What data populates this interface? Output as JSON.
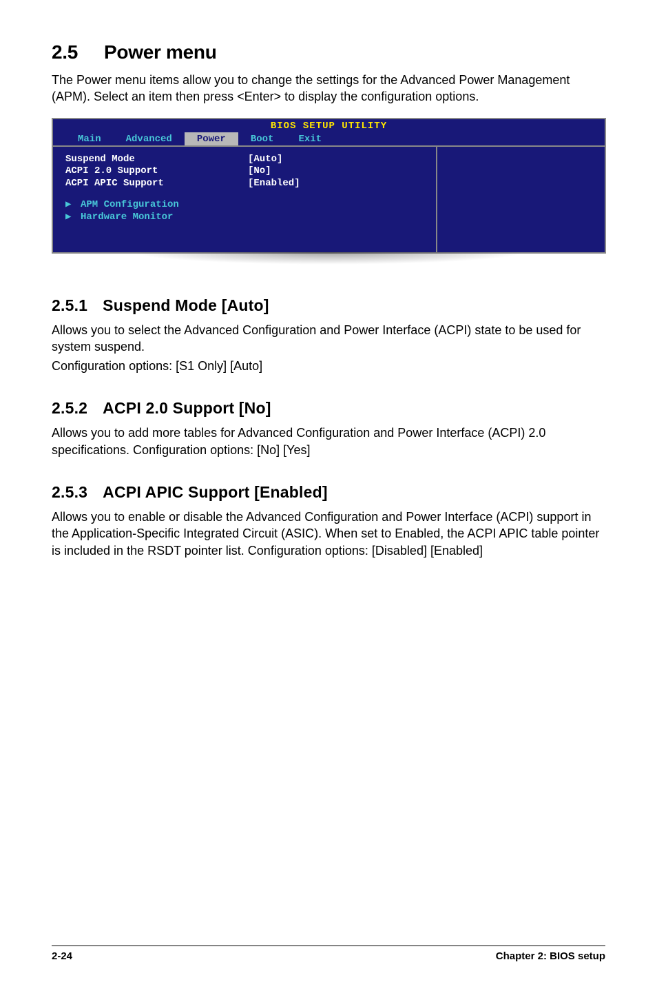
{
  "heading": {
    "number": "2.5",
    "title": "Power menu"
  },
  "intro": "The Power menu items allow you to change the settings for the Advanced Power Management (APM). Select an item then press <Enter> to display the configuration options.",
  "bios": {
    "title": "BIOS SETUP UTILITY",
    "tabs": {
      "main": "Main",
      "advanced": "Advanced",
      "power": "Power",
      "boot": "Boot",
      "exit": "Exit"
    },
    "rows": {
      "suspend_label": "Suspend Mode",
      "suspend_value": "[Auto]",
      "acpi20_label": "ACPI 2.0 Support",
      "acpi20_value": "[No]",
      "apic_label": "ACPI APIC Support",
      "apic_value": "[Enabled]"
    },
    "submenus": {
      "apm": "APM Configuration",
      "hw": "Hardware Monitor"
    }
  },
  "sections": {
    "s1": {
      "num": "2.5.1",
      "title": "Suspend Mode [Auto]",
      "p1": "Allows you to select the Advanced Configuration and Power Interface (ACPI) state to be used for system suspend.",
      "p2": "Configuration options: [S1 Only] [Auto]"
    },
    "s2": {
      "num": "2.5.2",
      "title": "ACPI 2.0 Support [No]",
      "p1": "Allows you to add more tables for Advanced Configuration and Power Interface (ACPI) 2.0 specifications. Configuration options: [No] [Yes]"
    },
    "s3": {
      "num": "2.5.3",
      "title": "ACPI APIC Support [Enabled]",
      "p1": "Allows you to enable or disable the Advanced Configuration and Power Interface (ACPI) support in the Application-Specific Integrated Circuit (ASIC). When set to Enabled, the ACPI APIC table pointer is included in the RSDT pointer list. Configuration options: [Disabled] [Enabled]"
    }
  },
  "footer": {
    "page": "2-24",
    "chapter": "Chapter 2: BIOS setup"
  }
}
